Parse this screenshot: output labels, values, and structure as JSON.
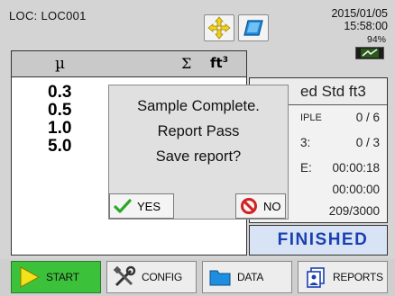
{
  "header": {
    "location": "LOC:  LOC001",
    "date": "2015/01/05",
    "time": "15:58:00",
    "battery_percent": "94%"
  },
  "table_header": {
    "size_col": "µ",
    "sum_col": "Σ",
    "volume_col": "ft",
    "volume_exp": "3"
  },
  "sizes": [
    "0.3",
    "0.5",
    "1.0",
    "5.0"
  ],
  "right_panel": {
    "title": "ed Std ft3",
    "sample_label": "IPLE",
    "sample_value": "0 / 6",
    "cycle_label": "3:",
    "cycle_value": "0 / 3",
    "elapsed_label": "E:",
    "elapsed_value": "00:00:18",
    "delay_value": "00:00:00",
    "buffer_value": "209/3000"
  },
  "status": "FINISHED",
  "dialog": {
    "line1": "Sample Complete.",
    "line2": "Report Pass",
    "line3": "Save report?",
    "yes_label": "YES",
    "no_label": "NO"
  },
  "nav": {
    "start": "START",
    "config": "CONFIG",
    "data": "DATA",
    "reports": "REPORTS"
  },
  "colors": {
    "start_green": "#3cc23a",
    "status_blue": "#1a3fb0",
    "no_red": "#d42020",
    "yes_green": "#2aa82a",
    "folder_blue": "#1f8ee0"
  }
}
